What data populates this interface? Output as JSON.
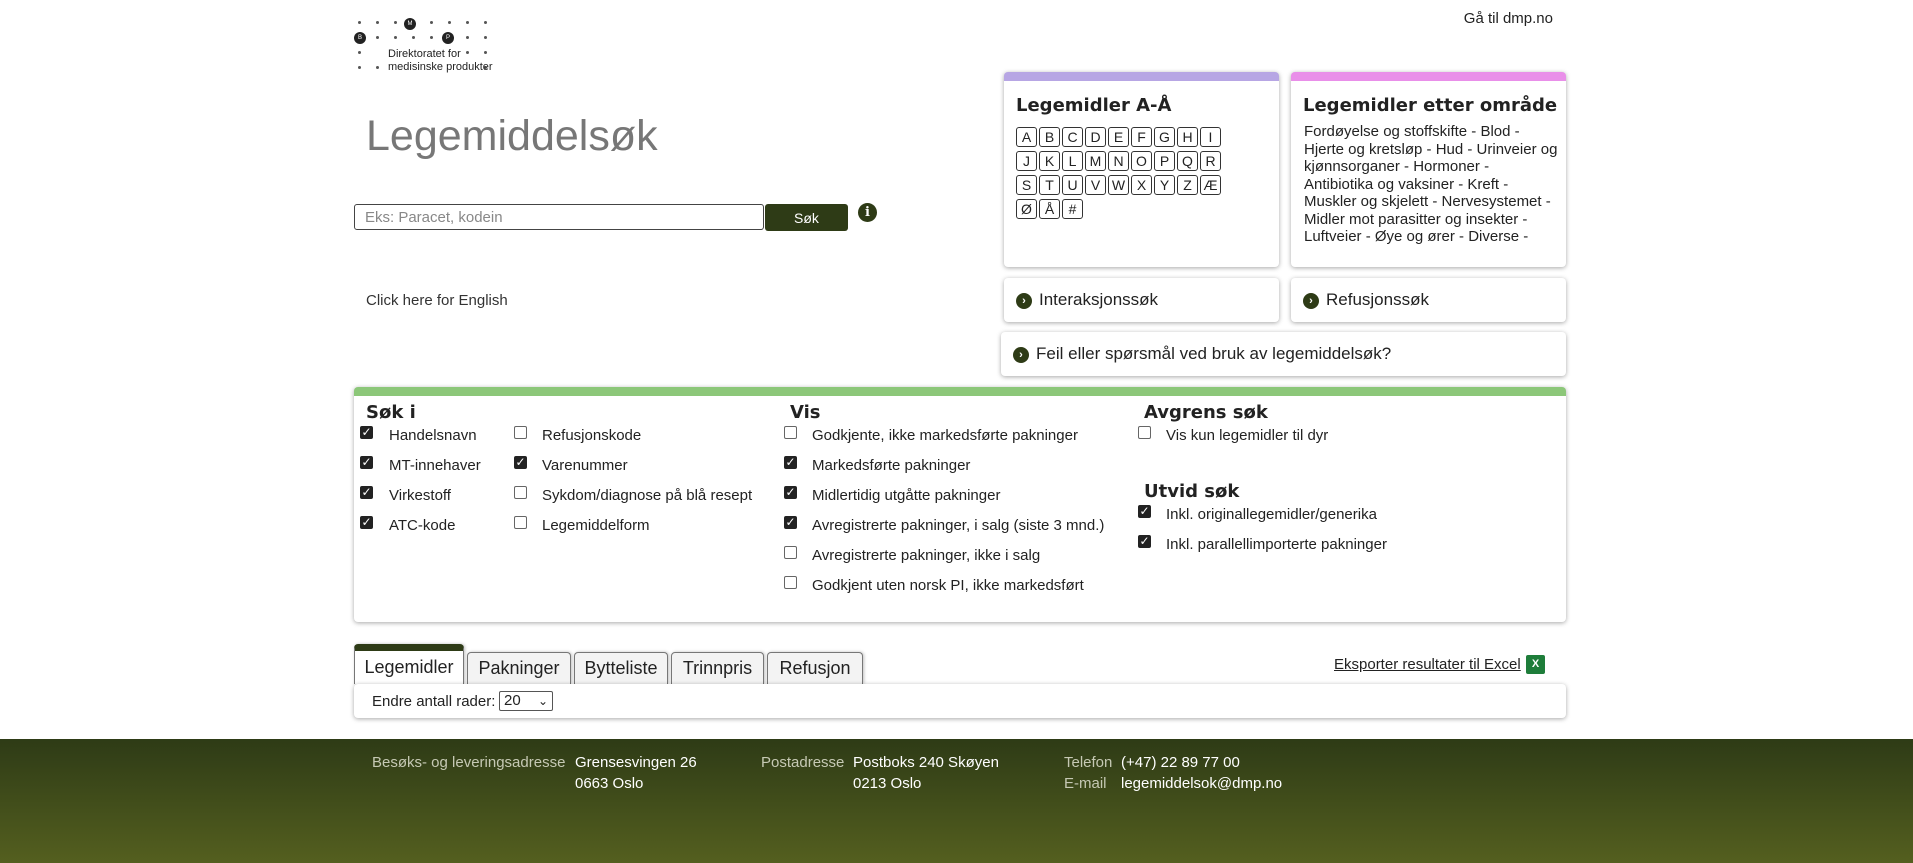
{
  "header": {
    "logo_text": "Direktoratet for medisinske produkter",
    "goto_link": "Gå til dmp.no"
  },
  "search": {
    "title": "Legemiddelsøk",
    "placeholder": "Eks: Paracet, kodein",
    "button": "Søk",
    "english_link": "Click here for English"
  },
  "az": {
    "title": "Legemidler A-Å",
    "letters": [
      "A",
      "B",
      "C",
      "D",
      "E",
      "F",
      "G",
      "H",
      "I",
      "J",
      "K",
      "L",
      "M",
      "N",
      "O",
      "P",
      "Q",
      "R",
      "S",
      "T",
      "U",
      "V",
      "W",
      "X",
      "Y",
      "Z",
      "Æ",
      "Ø",
      "Å",
      "#"
    ]
  },
  "areas": {
    "title": "Legemidler etter område",
    "text": "Fordøyelse og stoffskifte - Blod - Hjerte og kretsløp - Hud - Urinveier og kjønnsorganer - Hormoner - Antibiotika og vaksiner - Kreft - Muskler og skjelett - Nervesystemet - Midler mot parasitter og insekter - Luftveier - Øye og ører - Diverse -"
  },
  "links": {
    "interaction": "Interaksjonssøk",
    "refund": "Refusjonssøk",
    "feedback": "Feil eller spørsmål ved bruk av legemiddelsøk?"
  },
  "options": {
    "search_in": {
      "title": "Søk i",
      "items": [
        {
          "label": "Handelsnavn",
          "checked": true
        },
        {
          "label": "MT-innehaver",
          "checked": true
        },
        {
          "label": "Virkestoff",
          "checked": true
        },
        {
          "label": "ATC-kode",
          "checked": true
        },
        {
          "label": "Refusjonskode",
          "checked": false
        },
        {
          "label": "Varenummer",
          "checked": true
        },
        {
          "label": "Sykdom/diagnose på blå resept",
          "checked": false
        },
        {
          "label": "Legemiddelform",
          "checked": false
        }
      ]
    },
    "show": {
      "title": "Vis",
      "items": [
        {
          "label": "Godkjente, ikke markedsførte pakninger",
          "checked": false
        },
        {
          "label": "Markedsførte pakninger",
          "checked": true
        },
        {
          "label": "Midlertidig utgåtte pakninger",
          "checked": true
        },
        {
          "label": "Avregistrerte pakninger, i salg (siste 3 mnd.)",
          "checked": true
        },
        {
          "label": "Avregistrerte pakninger, ikke i salg",
          "checked": false
        },
        {
          "label": "Godkjent uten norsk PI, ikke markedsført",
          "checked": false
        }
      ]
    },
    "limit": {
      "title": "Avgrens søk",
      "items": [
        {
          "label": "Vis kun legemidler til dyr",
          "checked": false
        }
      ]
    },
    "expand": {
      "title": "Utvid søk",
      "items": [
        {
          "label": "Inkl. originallegemidler/generika",
          "checked": true
        },
        {
          "label": "Inkl. parallellimporterte pakninger",
          "checked": true
        }
      ]
    }
  },
  "tabs": [
    "Legemidler",
    "Pakninger",
    "Bytteliste",
    "Trinnpris",
    "Refusjon"
  ],
  "active_tab": "Legemidler",
  "export_link": "Eksporter resultater til Excel",
  "rows": {
    "label": "Endre antall rader:",
    "value": "20"
  },
  "footer": {
    "visit_label": "Besøks- og leveringsadresse",
    "visit_line1": "Grensesvingen 26",
    "visit_line2": "0663 Oslo",
    "post_label": "Postadresse",
    "post_line1": "Postboks 240 Skøyen",
    "post_line2": "0213 Oslo",
    "phone_label": "Telefon",
    "phone": "(+47) 22 89 77 00",
    "email_label": "E-mail",
    "email": "legemiddelsok@dmp.no"
  },
  "colors": {
    "dark_green": "#2e3b16",
    "az_accent": "#b7a6e4",
    "area_accent": "#e98fe9",
    "options_accent": "#8cc779"
  }
}
